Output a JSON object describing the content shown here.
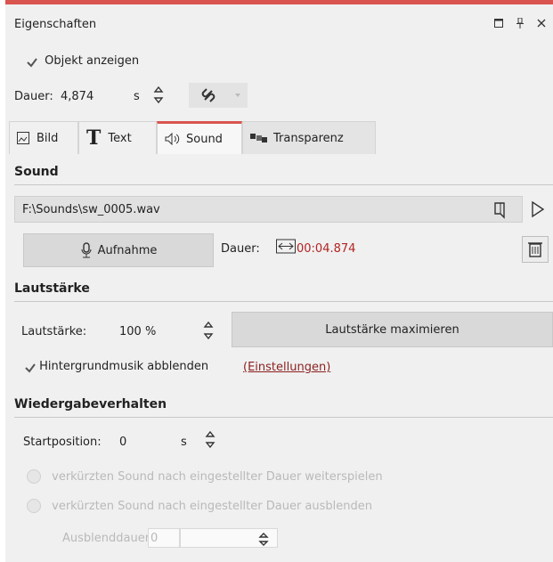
{
  "window": {
    "title": "Eigenschaften",
    "accent": "#d9534f"
  },
  "general": {
    "show_object_label": "Objekt anzeigen",
    "duration_label": "Dauer:",
    "duration_value": "4,874",
    "duration_unit": "s"
  },
  "tabs": [
    {
      "label": "Bild",
      "icon": "image-icon"
    },
    {
      "label": "Text",
      "icon": "text-icon"
    },
    {
      "label": "Sound",
      "icon": "speaker-icon"
    },
    {
      "label": "Transparenz",
      "icon": "transparency-icon"
    }
  ],
  "sound": {
    "header": "Sound",
    "file_path": "F:\\Sounds\\sw_0005.wav",
    "record_label": "Aufnahme",
    "duration_label": "Dauer:",
    "duration_value": "00:04.874"
  },
  "volume": {
    "header": "Lautstärke",
    "label": "Lautstärke:",
    "value": "100 %",
    "maximize_label": "Lautstärke maximieren",
    "fade_bg_label": "Hintergrundmusik abblenden",
    "settings_link": "(Einstellungen)"
  },
  "playback": {
    "header": "Wiedergabeverhalten",
    "start_label": "Startposition:",
    "start_value": "0",
    "start_unit": "s",
    "option1": "verkürzten Sound nach eingestellter Dauer weiterspielen",
    "option2": "verkürzten Sound nach eingestellter Dauer ausblenden",
    "fade_duration_label": "Ausblenddauer:",
    "fade_duration_value": "0"
  }
}
